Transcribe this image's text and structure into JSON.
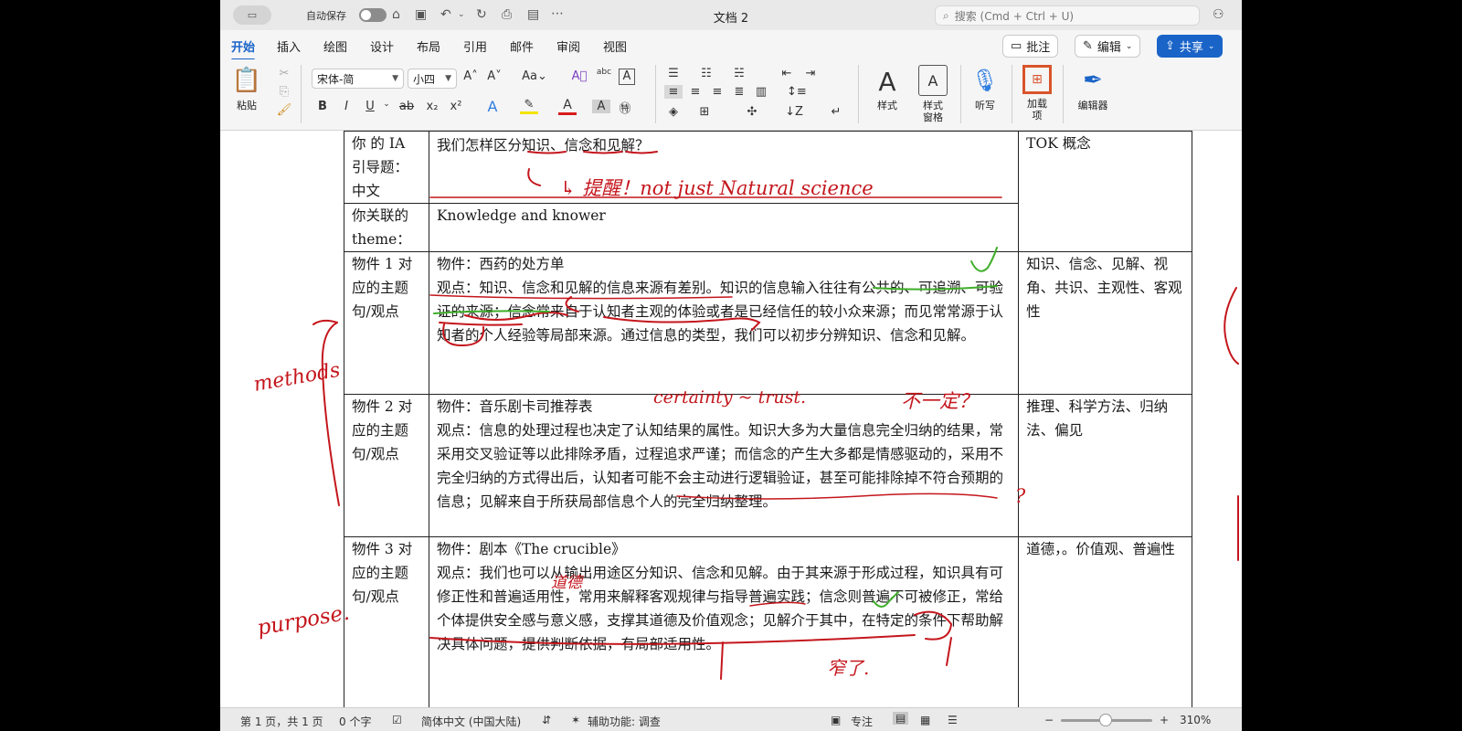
{
  "app": {
    "autosave_label": "自动保存",
    "doc_title": "文档 2",
    "search_placeholder": "搜索 (Cmd + Ctrl + U)"
  },
  "tabs": [
    {
      "label": "开始",
      "active": true
    },
    {
      "label": "插入"
    },
    {
      "label": "绘图"
    },
    {
      "label": "设计"
    },
    {
      "label": "布局"
    },
    {
      "label": "引用"
    },
    {
      "label": "邮件"
    },
    {
      "label": "审阅"
    },
    {
      "label": "视图"
    }
  ],
  "header_buttons": {
    "comment": "批注",
    "edit": "编辑",
    "share": "共享"
  },
  "ribbon": {
    "paste": "粘贴",
    "font_name": "宋体-简",
    "font_size": "小四",
    "styles": "样式",
    "styles_pane": "样式\n窗格",
    "dictate": "听写",
    "addins": "加载\n项",
    "editor": "编辑器"
  },
  "table": {
    "rows": [
      {
        "label": "你 的 IA 引导题：中文",
        "content": "我们怎样区分知识、信念和见解？",
        "concept": "TOK 概念"
      },
      {
        "label": "你关联的 theme：",
        "content": "Knowledge and knower",
        "concept": ""
      },
      {
        "label": "物件 1 对应的主题句/观点",
        "object": "物件：西药的处方单",
        "content": "观点：知识、信念和见解的信息来源有差别。知识的信息输入往往有公共的、可追溯、可验证的来源；信念常来自于认知者主观的体验或者是已经信任的较小众来源；而见常常源于认知者的个人经验等局部来源。通过信息的类型，我们可以初步分辨知识、信念和见解。",
        "concept": "知识、信念、见解、视角、共识、主观性、客观性"
      },
      {
        "label": "物件 2 对应的主题句/观点",
        "object": "物件：音乐剧卡司推荐表",
        "content": "观点：信息的处理过程也决定了认知结果的属性。知识大多为大量信息完全归纳的结果，常采用交叉验证等以此排除矛盾，过程追求严谨；而信念的产生大多都是情感驱动的，采用不完全归纳的方式得出后，认知者可能不会主动进行逻辑验证，甚至可能排除掉不符合预期的信息；见解来自于所获局部信息个人的完全归纳整理。",
        "concept": "推理、科学方法、归纳法、偏见"
      },
      {
        "label": "物件 3 对应的主题句/观点",
        "object": "物件：剧本《The crucible》",
        "content": "观点：我们也可以从输出用途区分知识、信念和见解。由于其来源于形成过程，知识具有可修正性和普遍适用性，常用来解释客观规律与指导普遍实践；信念则普遍不可被修正，常给个体提供安全感与意义感，支撑其道德及价值观念；见解介于其中，在特定的条件下帮助解决具体问题，提供判断依据，有局部适用性。",
        "concept": "道德，。价值观、普遍性"
      }
    ]
  },
  "ink": {
    "note1": "↳ 提醒！not just Natural science",
    "note2": "methods",
    "note3": "certainty ~ trust.",
    "note4": "不一定？",
    "note5": "?",
    "note6": "purpose.",
    "note7": "道德",
    "note8": "窄了."
  },
  "status": {
    "page": "第 1 页，共 1 页",
    "words": "0 个字",
    "language": "简体中文 (中国大陆)",
    "accessibility": "辅助功能: 调查",
    "focus": "专注",
    "zoom": "310%"
  },
  "colors": {
    "accent": "#1a64c8",
    "ink_red": "#c4161c",
    "ink_green": "#3fae2a"
  }
}
